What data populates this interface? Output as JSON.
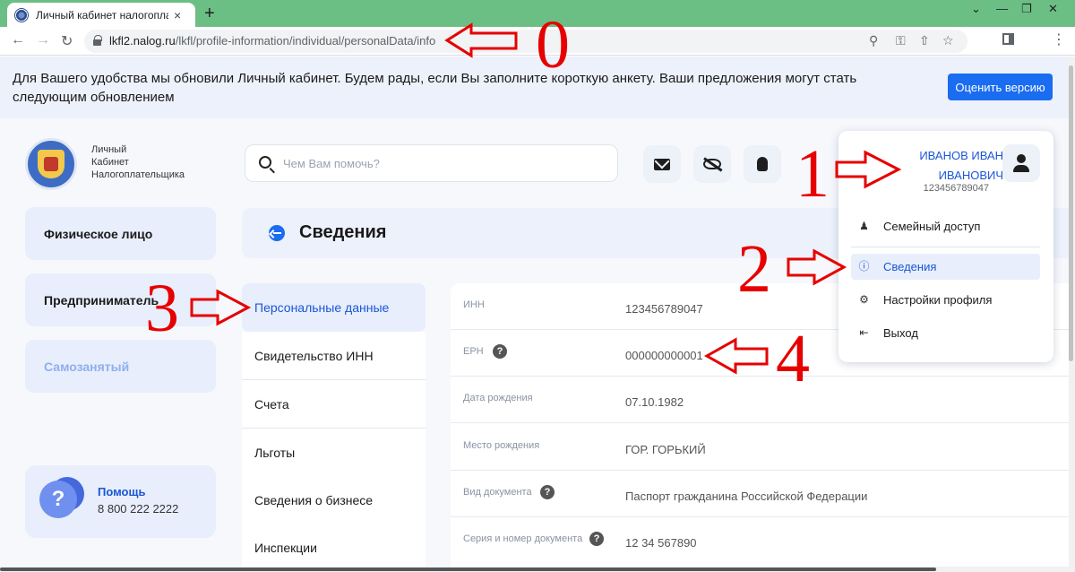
{
  "browser": {
    "tab_title": "Личный кабинет налогоплательщика",
    "tab_close": "×",
    "new_tab": "+",
    "url_host": "lkfl2.nalog.ru",
    "url_path": "/lkfl/profile-information/individual/personalData/info",
    "window_controls": [
      "⌄",
      "—",
      "❐",
      "✕"
    ],
    "icons": [
      "back-arrow-icon",
      "forward-arrow-icon",
      "reload-icon",
      "lock-icon",
      "zoom-icon",
      "key-icon",
      "share-icon",
      "star-icon",
      "side-panel-icon",
      "kebab-menu-icon"
    ]
  },
  "banner": {
    "text": "Для Вашего удобства мы обновили Личный кабинет. Будем рады, если Вы заполните короткую анкету. Ваши предложения могут стать следующим обновлением",
    "button": "Оценить версию"
  },
  "logo": {
    "line1": "Личный",
    "line2": "Кабинет",
    "line3": "Налогоплательщика"
  },
  "search": {
    "placeholder": "Чем Вам помочь?"
  },
  "header_icons": [
    "mail-icon",
    "eye-off-icon",
    "lightbulb-icon"
  ],
  "sidebar": {
    "items": [
      {
        "label": "Физическое лицо"
      },
      {
        "label": "Предприниматель"
      },
      {
        "label": "Самозанятый"
      }
    ],
    "help": {
      "icon": "?",
      "title": "Помощь",
      "phone": "8 800 222 2222"
    }
  },
  "page": {
    "title": "Сведения"
  },
  "subnav": [
    {
      "label": "Персональные данные",
      "active": true
    },
    {
      "label": "Свидетельство ИНН"
    },
    {
      "label": "Счета"
    },
    {
      "label": "Льготы"
    },
    {
      "label": "Сведения о бизнесе"
    },
    {
      "label": "Инспекции"
    }
  ],
  "personal_data": [
    {
      "label": "ИНН",
      "value": "123456789047"
    },
    {
      "label": "ЕРН",
      "value": "000000000001",
      "help": true
    },
    {
      "label": "Дата рождения",
      "value": "07.10.1982"
    },
    {
      "label": "Место рождения",
      "value": "ГОР. ГОРЬКИЙ"
    },
    {
      "label": "Вид документа",
      "value": "Паспорт гражданина Российской Федерации",
      "help": true
    },
    {
      "label": "Серия и номер документа",
      "value": "12 34 567890",
      "help": true
    }
  ],
  "profile_menu": {
    "name_line1": "ИВАНОВ ИВАН",
    "name_line2": "ИВАНОВИЧ",
    "inn": "123456789047",
    "items": [
      {
        "label": "Семейный доступ",
        "icon": "family-icon"
      },
      {
        "label": "Сведения",
        "icon": "info-icon",
        "active": true
      },
      {
        "label": "Настройки профиля",
        "icon": "settings-icon"
      },
      {
        "label": "Выход",
        "icon": "logout-icon"
      }
    ]
  },
  "annotations": {
    "numbers": [
      "0",
      "1",
      "2",
      "3",
      "4"
    ],
    "color": "#e60000"
  },
  "colors": {
    "accent": "#1a6cf0",
    "link": "#1a56d6",
    "tabstrip": "#6cbf84",
    "banner_bg": "#edf1fb",
    "annotation": "#e60000"
  }
}
